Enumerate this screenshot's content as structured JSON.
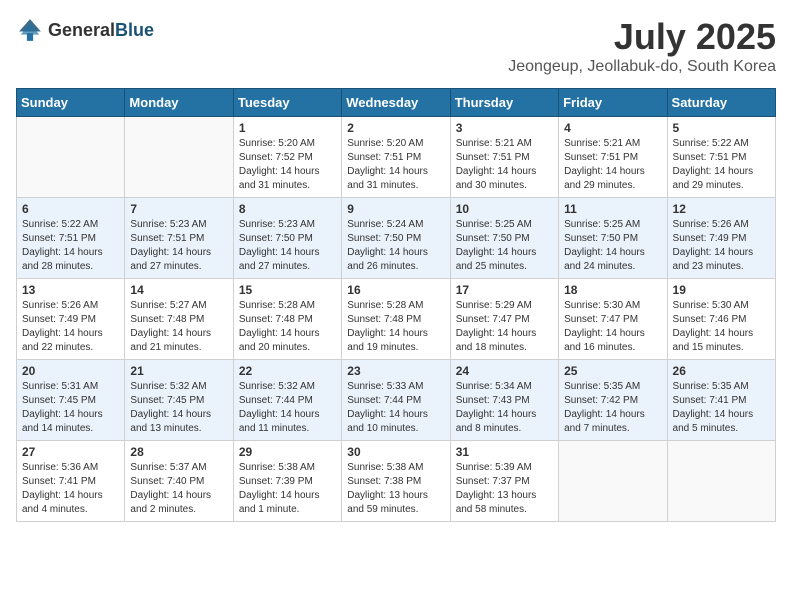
{
  "header": {
    "logo_general": "General",
    "logo_blue": "Blue",
    "title": "July 2025",
    "location": "Jeongeup, Jeollabuk-do, South Korea"
  },
  "days_of_week": [
    "Sunday",
    "Monday",
    "Tuesday",
    "Wednesday",
    "Thursday",
    "Friday",
    "Saturday"
  ],
  "weeks": [
    [
      {
        "day": "",
        "detail": ""
      },
      {
        "day": "",
        "detail": ""
      },
      {
        "day": "1",
        "detail": "Sunrise: 5:20 AM\nSunset: 7:52 PM\nDaylight: 14 hours and 31 minutes."
      },
      {
        "day": "2",
        "detail": "Sunrise: 5:20 AM\nSunset: 7:51 PM\nDaylight: 14 hours and 31 minutes."
      },
      {
        "day": "3",
        "detail": "Sunrise: 5:21 AM\nSunset: 7:51 PM\nDaylight: 14 hours and 30 minutes."
      },
      {
        "day": "4",
        "detail": "Sunrise: 5:21 AM\nSunset: 7:51 PM\nDaylight: 14 hours and 29 minutes."
      },
      {
        "day": "5",
        "detail": "Sunrise: 5:22 AM\nSunset: 7:51 PM\nDaylight: 14 hours and 29 minutes."
      }
    ],
    [
      {
        "day": "6",
        "detail": "Sunrise: 5:22 AM\nSunset: 7:51 PM\nDaylight: 14 hours and 28 minutes."
      },
      {
        "day": "7",
        "detail": "Sunrise: 5:23 AM\nSunset: 7:51 PM\nDaylight: 14 hours and 27 minutes."
      },
      {
        "day": "8",
        "detail": "Sunrise: 5:23 AM\nSunset: 7:50 PM\nDaylight: 14 hours and 27 minutes."
      },
      {
        "day": "9",
        "detail": "Sunrise: 5:24 AM\nSunset: 7:50 PM\nDaylight: 14 hours and 26 minutes."
      },
      {
        "day": "10",
        "detail": "Sunrise: 5:25 AM\nSunset: 7:50 PM\nDaylight: 14 hours and 25 minutes."
      },
      {
        "day": "11",
        "detail": "Sunrise: 5:25 AM\nSunset: 7:50 PM\nDaylight: 14 hours and 24 minutes."
      },
      {
        "day": "12",
        "detail": "Sunrise: 5:26 AM\nSunset: 7:49 PM\nDaylight: 14 hours and 23 minutes."
      }
    ],
    [
      {
        "day": "13",
        "detail": "Sunrise: 5:26 AM\nSunset: 7:49 PM\nDaylight: 14 hours and 22 minutes."
      },
      {
        "day": "14",
        "detail": "Sunrise: 5:27 AM\nSunset: 7:48 PM\nDaylight: 14 hours and 21 minutes."
      },
      {
        "day": "15",
        "detail": "Sunrise: 5:28 AM\nSunset: 7:48 PM\nDaylight: 14 hours and 20 minutes."
      },
      {
        "day": "16",
        "detail": "Sunrise: 5:28 AM\nSunset: 7:48 PM\nDaylight: 14 hours and 19 minutes."
      },
      {
        "day": "17",
        "detail": "Sunrise: 5:29 AM\nSunset: 7:47 PM\nDaylight: 14 hours and 18 minutes."
      },
      {
        "day": "18",
        "detail": "Sunrise: 5:30 AM\nSunset: 7:47 PM\nDaylight: 14 hours and 16 minutes."
      },
      {
        "day": "19",
        "detail": "Sunrise: 5:30 AM\nSunset: 7:46 PM\nDaylight: 14 hours and 15 minutes."
      }
    ],
    [
      {
        "day": "20",
        "detail": "Sunrise: 5:31 AM\nSunset: 7:45 PM\nDaylight: 14 hours and 14 minutes."
      },
      {
        "day": "21",
        "detail": "Sunrise: 5:32 AM\nSunset: 7:45 PM\nDaylight: 14 hours and 13 minutes."
      },
      {
        "day": "22",
        "detail": "Sunrise: 5:32 AM\nSunset: 7:44 PM\nDaylight: 14 hours and 11 minutes."
      },
      {
        "day": "23",
        "detail": "Sunrise: 5:33 AM\nSunset: 7:44 PM\nDaylight: 14 hours and 10 minutes."
      },
      {
        "day": "24",
        "detail": "Sunrise: 5:34 AM\nSunset: 7:43 PM\nDaylight: 14 hours and 8 minutes."
      },
      {
        "day": "25",
        "detail": "Sunrise: 5:35 AM\nSunset: 7:42 PM\nDaylight: 14 hours and 7 minutes."
      },
      {
        "day": "26",
        "detail": "Sunrise: 5:35 AM\nSunset: 7:41 PM\nDaylight: 14 hours and 5 minutes."
      }
    ],
    [
      {
        "day": "27",
        "detail": "Sunrise: 5:36 AM\nSunset: 7:41 PM\nDaylight: 14 hours and 4 minutes."
      },
      {
        "day": "28",
        "detail": "Sunrise: 5:37 AM\nSunset: 7:40 PM\nDaylight: 14 hours and 2 minutes."
      },
      {
        "day": "29",
        "detail": "Sunrise: 5:38 AM\nSunset: 7:39 PM\nDaylight: 14 hours and 1 minute."
      },
      {
        "day": "30",
        "detail": "Sunrise: 5:38 AM\nSunset: 7:38 PM\nDaylight: 13 hours and 59 minutes."
      },
      {
        "day": "31",
        "detail": "Sunrise: 5:39 AM\nSunset: 7:37 PM\nDaylight: 13 hours and 58 minutes."
      },
      {
        "day": "",
        "detail": ""
      },
      {
        "day": "",
        "detail": ""
      }
    ]
  ]
}
